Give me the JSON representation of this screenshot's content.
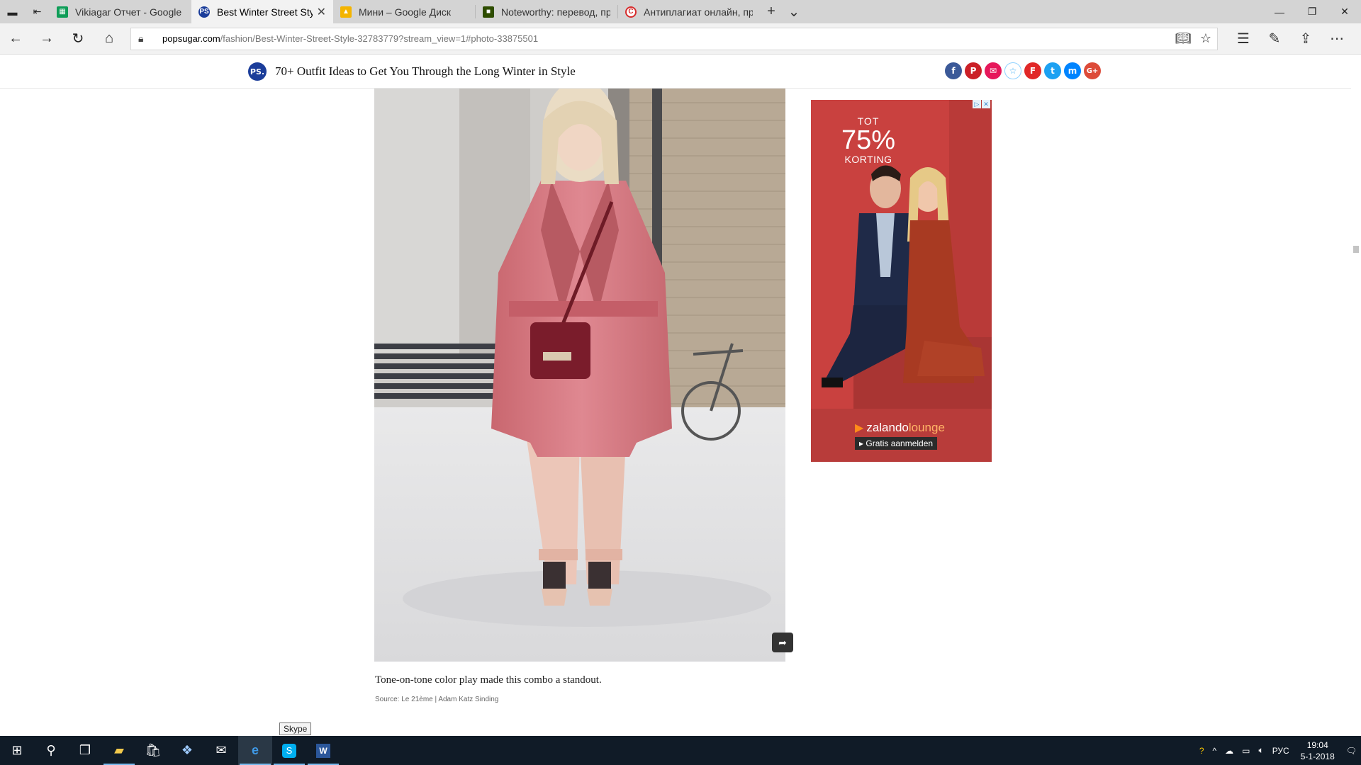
{
  "browser": {
    "tabs": [
      {
        "title": "Vikiagar Отчет - Google Таб",
        "favicon_color": "#0f9d58",
        "active": false
      },
      {
        "title": "Best Winter Street Style",
        "favicon_color": "#1b3d9a",
        "active": true
      },
      {
        "title": "Мини – Google Диск",
        "favicon_color": "#f4b400",
        "active": false
      },
      {
        "title": "Noteworthy: перевод, прои",
        "favicon_color": "#5a8f00",
        "active": false
      },
      {
        "title": "Антиплагиат онлайн, пров",
        "favicon_color": "#d62d2d",
        "active": false
      }
    ],
    "url_host": "popsugar.com",
    "url_path": "/fashion/Best-Winter-Street-Style-32783779?stream_view=1#photo-33875501"
  },
  "page": {
    "logo_text": "PS.",
    "title": "70+ Outfit Ideas to Get You Through the Long Winter in Style",
    "share_icons": [
      {
        "name": "facebook",
        "glyph": "f",
        "color": "#3b5998"
      },
      {
        "name": "pinterest",
        "glyph": "P",
        "color": "#cb2027"
      },
      {
        "name": "email",
        "glyph": "✉",
        "color": "#e6185b"
      },
      {
        "name": "favorite",
        "glyph": "☆",
        "color": "#ffffff"
      },
      {
        "name": "flipboard",
        "glyph": "F",
        "color": "#e12828"
      },
      {
        "name": "twitter",
        "glyph": "t",
        "color": "#1da1f2"
      },
      {
        "name": "messenger",
        "glyph": "m",
        "color": "#0084ff"
      },
      {
        "name": "google-plus",
        "glyph": "G+",
        "color": "#dd4b39"
      }
    ],
    "caption": "Tone-on-tone color play made this combo a standout.",
    "source": "Source: Le 21ème | Adam Katz Sinding"
  },
  "ad": {
    "line1": "TOT",
    "line2": "75%",
    "line3": "KORTING",
    "brand_a": "zalando",
    "brand_b": "lounge",
    "cta": "▸ Gratis aanmelden"
  },
  "tooltip": "Skype",
  "taskbar": {
    "lang": "РУС",
    "time": "19:04",
    "date": "5-1-2018"
  }
}
